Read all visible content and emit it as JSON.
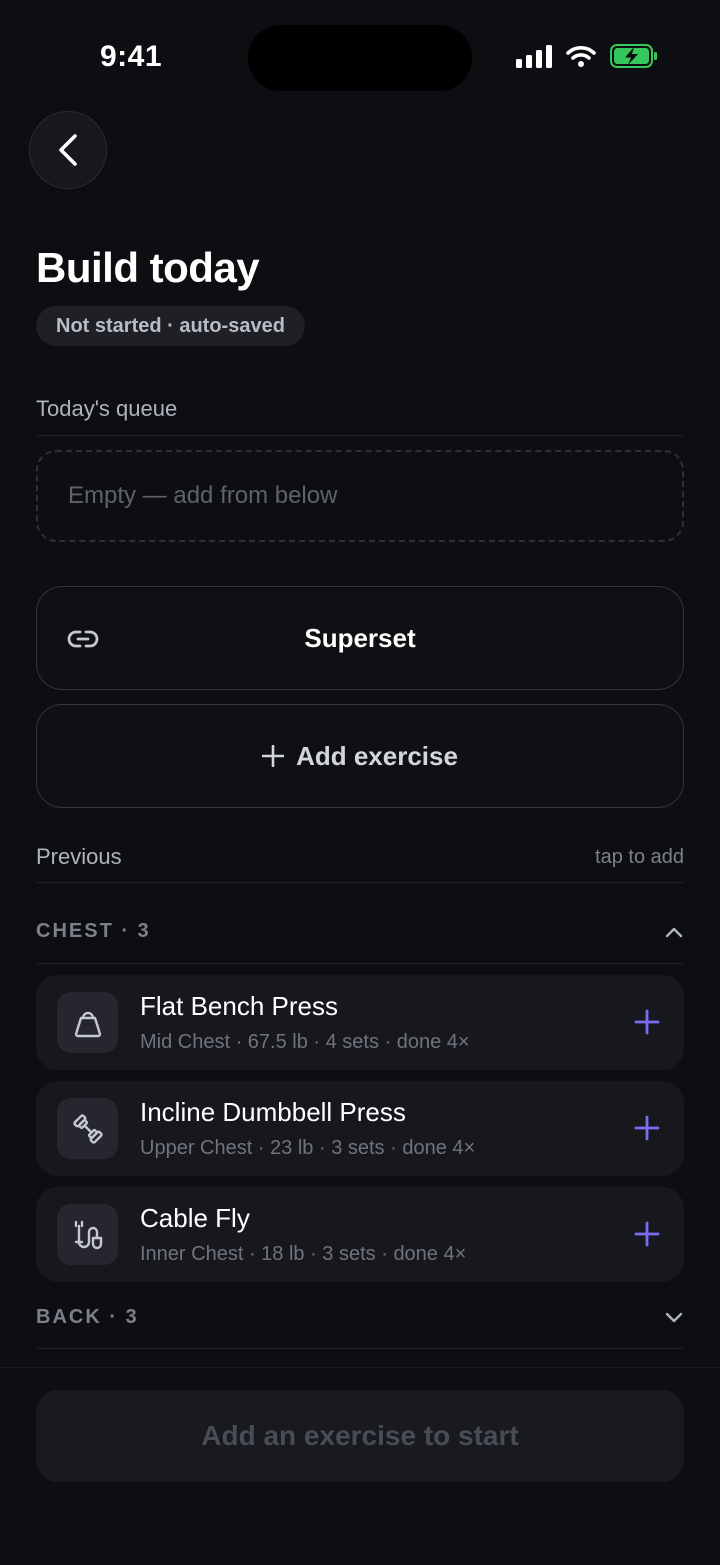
{
  "status_bar": {
    "time": "9:41"
  },
  "header": {
    "title": "Build today",
    "status": "Not started · auto-saved"
  },
  "queue": {
    "label": "Today's queue",
    "empty_text": "Empty — add from below"
  },
  "actions": {
    "superset_label": "Superset",
    "add_exercise_label": "Add exercise"
  },
  "previous": {
    "label": "Previous",
    "hint": "tap to add"
  },
  "groups": [
    {
      "label": "CHEST · 3",
      "expanded": true,
      "items": [
        {
          "name": "Flat Bench Press",
          "meta": "Mid Chest · 67.5 lb · 4 sets · done 4×",
          "icon": "kettlebell-icon"
        },
        {
          "name": "Incline Dumbbell Press",
          "meta": "Upper Chest · 23 lb · 3 sets · done 4×",
          "icon": "dumbbell-icon"
        },
        {
          "name": "Cable Fly",
          "meta": "Inner Chest · 18 lb · 3 sets · done 4×",
          "icon": "cable-icon"
        }
      ]
    },
    {
      "label": "BACK · 3",
      "expanded": false
    }
  ],
  "footer": {
    "start_label": "Add an exercise to start"
  },
  "colors": {
    "accent": "#7b6cf6",
    "background": "#0d0e12",
    "card": "#17181d",
    "battery": "#34c759"
  }
}
